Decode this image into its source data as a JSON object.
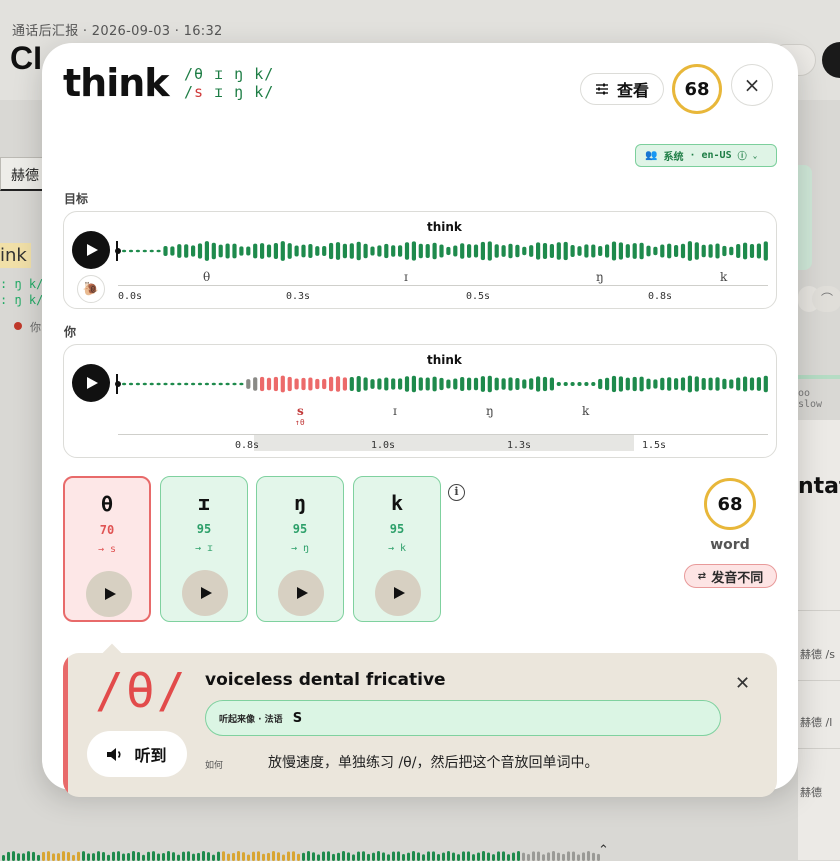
{
  "background": {
    "context_line": "通话后汇报 · 2026-09-03 · 16:32",
    "big_title": "CI",
    "tab_label": "赫德",
    "word": "ink",
    "ipa_line1": ": ŋ k/",
    "ipa_line2": ": ŋ k/",
    "you_label": "你",
    "right_title": "ntati",
    "slow_label": "oo slow",
    "right_rows": [
      "赫德 /s",
      "赫德 /l",
      "赫德"
    ]
  },
  "modal": {
    "word": "think",
    "ipa_target": "/θ ɪ ŋ k/",
    "ipa_user_bad": "s",
    "ipa_user_rest": " ɪ ŋ k/",
    "ipa_user_open": "/",
    "view_button": "查看",
    "overall_score": "68",
    "close_icon": "×",
    "voice": {
      "label": "系统",
      "locale": "en-US",
      "separator": "·"
    },
    "target_section": {
      "label": "目标",
      "word": "think",
      "phonemes": [
        "θ",
        "ɪ",
        "ŋ",
        "k"
      ],
      "times": [
        "0.0s",
        "0.3s",
        "0.5s",
        "0.8s"
      ]
    },
    "user_section": {
      "label": "你",
      "word": "think",
      "phonemes": [
        "s",
        "ɪ",
        "ŋ",
        "k"
      ],
      "bad_note": "↑θ",
      "times": [
        "0.8s",
        "1.0s",
        "1.3s",
        "1.5s"
      ]
    },
    "tiles": [
      {
        "symbol": "θ",
        "score": "70",
        "heard": "→ s",
        "status": "bad"
      },
      {
        "symbol": "ɪ",
        "score": "95",
        "heard": "→ ɪ",
        "status": "good"
      },
      {
        "symbol": "ŋ",
        "score": "95",
        "heard": "→ ŋ",
        "status": "good"
      },
      {
        "symbol": "k",
        "score": "95",
        "heard": "→ k",
        "status": "good"
      }
    ],
    "info_icon": "i",
    "word_score": "68",
    "word_label": "word",
    "diff_badge": "发音不同",
    "colors": {
      "good": "#2da06a",
      "bad": "#e05454",
      "score_ring": "#e8b73a"
    }
  },
  "detail": {
    "symbol": "/θ/",
    "listen_button": "听到",
    "name": "voiceless dental fricative",
    "sounds_like_label": "听起来像 · 法语",
    "sounds_like_value": "S",
    "how_label": "如何",
    "tip": "放慢速度，单独练习 /θ/，然后把这个音放回单词中。"
  }
}
